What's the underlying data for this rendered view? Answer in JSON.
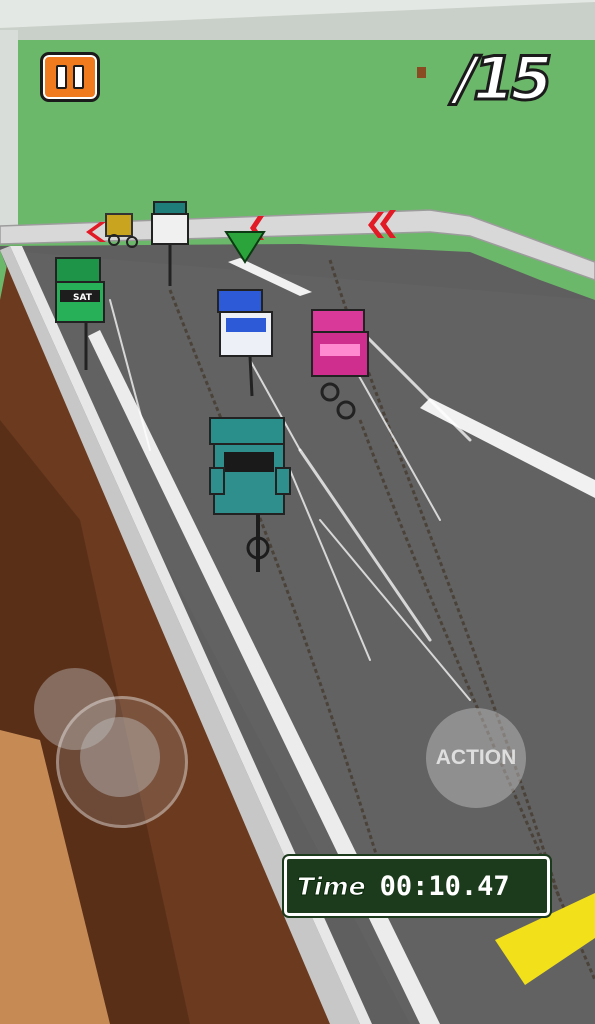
{
  "hud": {
    "pause_icon": "pause-icon",
    "laps_text": "/15",
    "action_label": "ACTION",
    "timer_label": "Time",
    "timer_value": "00:10.47"
  },
  "riders": [
    {
      "name": "green-rider",
      "jersey": "SAT"
    },
    {
      "name": "teal-white-rider"
    },
    {
      "name": "yellow-rider"
    },
    {
      "name": "blue-rider"
    },
    {
      "name": "pink-rider"
    },
    {
      "name": "teal-rider-player"
    }
  ],
  "colors": {
    "grass": "#6cb86a",
    "track": "#5f5f60",
    "wall": "#6b3a1f",
    "finish": "#f2e01a",
    "pause_orange": "#f07a1e",
    "timer_bg": "#1c3b1c",
    "marker_green": "#2ba53b",
    "chevron_red": "#e21a25"
  }
}
